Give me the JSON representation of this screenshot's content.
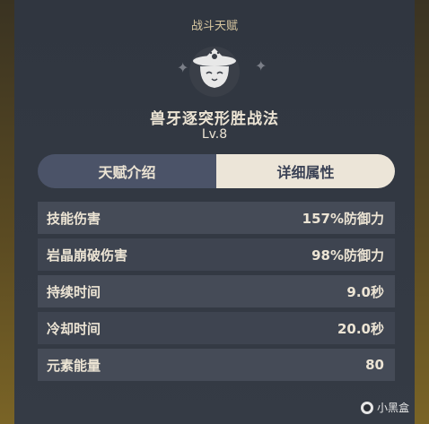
{
  "header": {
    "category": "战斗天赋",
    "skill_name": "兽牙逐突形胜战法",
    "level": "Lv.8"
  },
  "icon": {
    "name": "cat-hat-icon"
  },
  "tabs": [
    {
      "label": "天赋介绍",
      "active": false
    },
    {
      "label": "详细属性",
      "active": true
    }
  ],
  "attributes": [
    {
      "label": "技能伤害",
      "value": "157%防御力"
    },
    {
      "label": "岩晶崩破伤害",
      "value": "98%防御力"
    },
    {
      "label": "持续时间",
      "value": "9.0秒"
    },
    {
      "label": "冷却时间",
      "value": "20.0秒"
    },
    {
      "label": "元素能量",
      "value": "80"
    }
  ],
  "watermark": {
    "text": "小黑盒"
  },
  "colors": {
    "accent_light": "#ece5d8",
    "tab_inactive": "#4b5368",
    "text": "#ece4d4",
    "gold_frame": "#7a6426"
  }
}
